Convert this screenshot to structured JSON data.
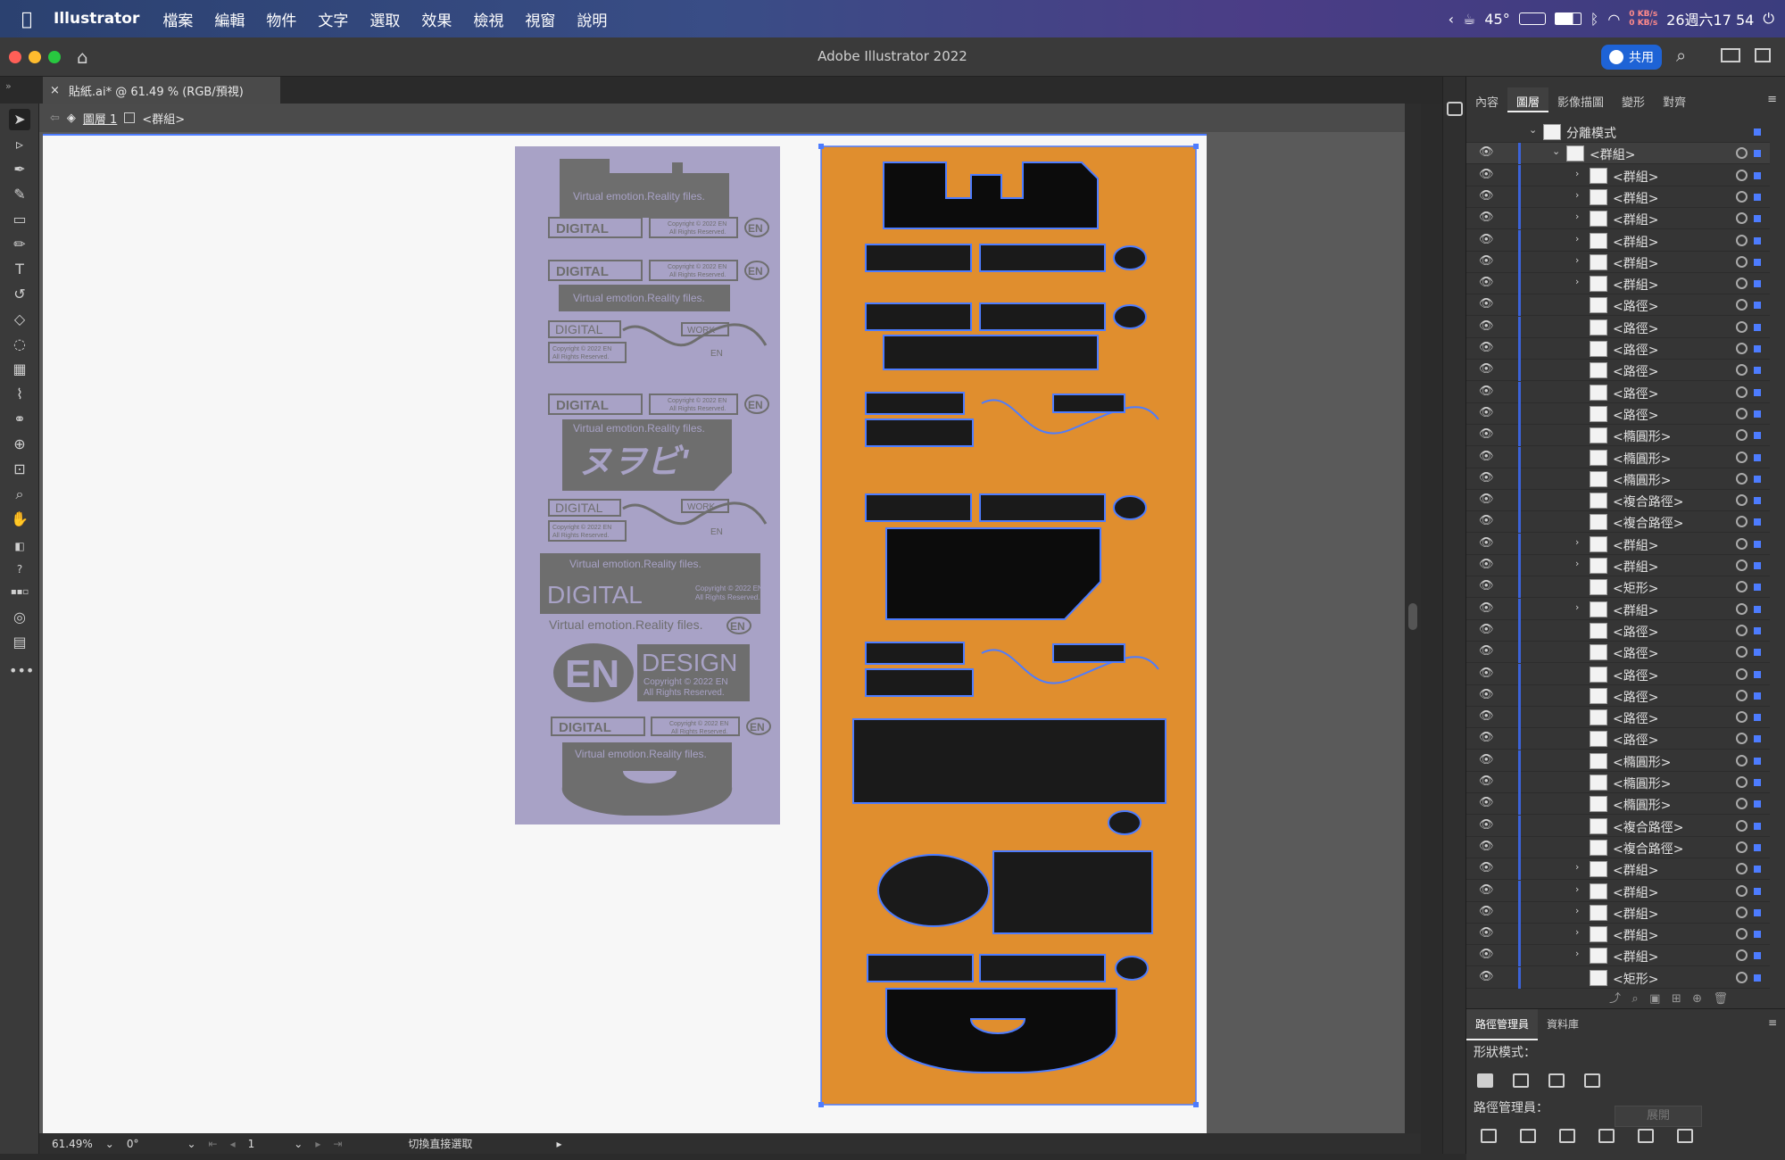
{
  "menubar": {
    "apple": "",
    "app_name": "Illustrator",
    "menus": [
      "檔案",
      "編輯",
      "物件",
      "文字",
      "選取",
      "效果",
      "檢視",
      "視窗",
      "說明"
    ],
    "status": {
      "temp": "45°",
      "kbs_up": "0 KB/s",
      "kbs_down": "0 KB/s",
      "datetime": "26週六17 54"
    }
  },
  "titlebar": {
    "title": "Adobe Illustrator 2022",
    "share_label": "共用"
  },
  "document_tab": {
    "close": "×",
    "label": "貼紙.ai* @ 61.49 % (RGB/預視)"
  },
  "breadcrumb": {
    "layer": "圖層 1",
    "group": "<群組>"
  },
  "artwork": {
    "gray_panel": {
      "slogan": "Virtual emotion.Reality files.",
      "digital": "DIGITAL",
      "copyright_1": "Copyright © 2022 EN",
      "copyright_2": "All Rights Reserved.",
      "en": "EN",
      "work": "WORK",
      "japanese": "ヌヲビ'",
      "design": "DESIGN"
    },
    "colors": {
      "gray_bg": "#a8a2c6",
      "gray_ink": "#6e6e6e",
      "orange_bg": "#e08e2e",
      "selection": "#4d7cff"
    }
  },
  "statusbar": {
    "zoom": "61.49%",
    "rotate": "0°",
    "page": "1",
    "tool_hint": "切換直接選取"
  },
  "panels": {
    "tabs": [
      "內容",
      "圖層",
      "影像描圖",
      "變形",
      "對齊"
    ],
    "active_tab": "圖層",
    "layers": [
      {
        "name": "分離模式",
        "indent": 0,
        "chev": "⌄"
      },
      {
        "name": "<群組>",
        "indent": 1,
        "chev": "⌄"
      },
      {
        "name": "<群組>",
        "indent": 2,
        "chev": "›"
      },
      {
        "name": "<群組>",
        "indent": 2,
        "chev": "›"
      },
      {
        "name": "<群組>",
        "indent": 2,
        "chev": "›"
      },
      {
        "name": "<群組>",
        "indent": 2,
        "chev": "›"
      },
      {
        "name": "<群組>",
        "indent": 2,
        "chev": "›"
      },
      {
        "name": "<群組>",
        "indent": 2,
        "chev": "›"
      },
      {
        "name": "<路徑>",
        "indent": 2,
        "chev": ""
      },
      {
        "name": "<路徑>",
        "indent": 2,
        "chev": ""
      },
      {
        "name": "<路徑>",
        "indent": 2,
        "chev": ""
      },
      {
        "name": "<路徑>",
        "indent": 2,
        "chev": ""
      },
      {
        "name": "<路徑>",
        "indent": 2,
        "chev": ""
      },
      {
        "name": "<路徑>",
        "indent": 2,
        "chev": ""
      },
      {
        "name": "<橢圓形>",
        "indent": 2,
        "chev": ""
      },
      {
        "name": "<橢圓形>",
        "indent": 2,
        "chev": ""
      },
      {
        "name": "<橢圓形>",
        "indent": 2,
        "chev": ""
      },
      {
        "name": "<複合路徑>",
        "indent": 2,
        "chev": ""
      },
      {
        "name": "<複合路徑>",
        "indent": 2,
        "chev": ""
      },
      {
        "name": "<群組>",
        "indent": 2,
        "chev": "›"
      },
      {
        "name": "<群組>",
        "indent": 2,
        "chev": "›"
      },
      {
        "name": "<矩形>",
        "indent": 2,
        "chev": ""
      },
      {
        "name": "<群組>",
        "indent": 2,
        "chev": "›"
      },
      {
        "name": "<路徑>",
        "indent": 2,
        "chev": ""
      },
      {
        "name": "<路徑>",
        "indent": 2,
        "chev": ""
      },
      {
        "name": "<路徑>",
        "indent": 2,
        "chev": ""
      },
      {
        "name": "<路徑>",
        "indent": 2,
        "chev": ""
      },
      {
        "name": "<路徑>",
        "indent": 2,
        "chev": ""
      },
      {
        "name": "<路徑>",
        "indent": 2,
        "chev": ""
      },
      {
        "name": "<橢圓形>",
        "indent": 2,
        "chev": ""
      },
      {
        "name": "<橢圓形>",
        "indent": 2,
        "chev": ""
      },
      {
        "name": "<橢圓形>",
        "indent": 2,
        "chev": ""
      },
      {
        "name": "<複合路徑>",
        "indent": 2,
        "chev": ""
      },
      {
        "name": "<複合路徑>",
        "indent": 2,
        "chev": ""
      },
      {
        "name": "<群組>",
        "indent": 2,
        "chev": "›"
      },
      {
        "name": "<群組>",
        "indent": 2,
        "chev": "›"
      },
      {
        "name": "<群組>",
        "indent": 2,
        "chev": "›"
      },
      {
        "name": "<群組>",
        "indent": 2,
        "chev": "›"
      },
      {
        "name": "<群組>",
        "indent": 2,
        "chev": "›"
      },
      {
        "name": "<矩形>",
        "indent": 2,
        "chev": ""
      }
    ],
    "pathfinder": {
      "tabs": [
        "路徑管理員",
        "資料庫"
      ],
      "shape_modes_label": "形狀模式：",
      "expand_label": "展開",
      "pathfinders_label": "路徑管理員："
    }
  }
}
